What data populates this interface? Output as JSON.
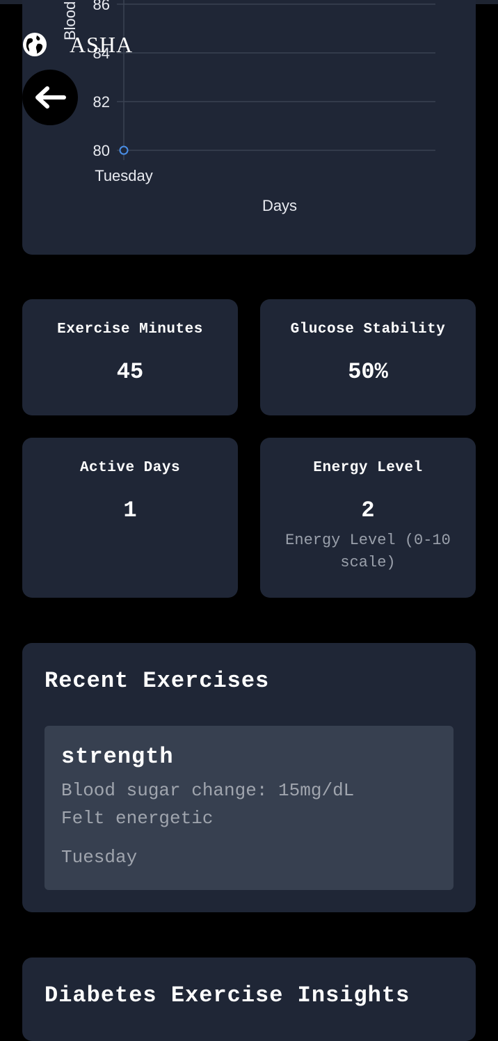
{
  "app": {
    "name": "ASHA"
  },
  "icons": {
    "globe": "globe-icon",
    "back": "arrow-left-icon"
  },
  "chart": {
    "partial_axis_title": "Blood",
    "chart_data": {
      "type": "line",
      "categories": [
        "Tuesday"
      ],
      "series": [
        {
          "values": [
            80
          ]
        }
      ],
      "xlabel": "Days",
      "ylabel": "Blood",
      "y_ticks": [
        "80",
        "82",
        "84",
        "86"
      ],
      "ylim": [
        80,
        86
      ],
      "grid": true,
      "colors": {
        "line": "#4a8fe7",
        "grid": "#3a4252"
      }
    }
  },
  "stats": {
    "exercise_minutes": {
      "label": "Exercise Minutes",
      "value": "45"
    },
    "glucose_stability": {
      "label": "Glucose Stability",
      "value": "50%"
    },
    "active_days": {
      "label": "Active Days",
      "value": "1"
    },
    "energy_level": {
      "label": "Energy Level",
      "value": "2",
      "sub": "Energy Level (0-10 scale)"
    }
  },
  "recent": {
    "title": "Recent Exercises",
    "items": [
      {
        "type": "strength",
        "blood_sugar": "Blood sugar change: 15mg/dL",
        "feeling": "Felt energetic",
        "day": "Tuesday"
      }
    ]
  },
  "insights": {
    "title": "Diabetes Exercise Insights"
  }
}
